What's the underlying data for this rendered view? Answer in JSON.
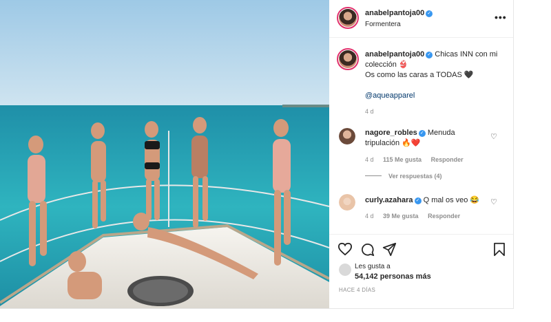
{
  "post": {
    "image_alt": "Group of women in swimsuits posing on the bow of a boat at sea",
    "colors": {
      "sky": "#a8cfe8",
      "sea": "#2aa7b4",
      "deck": "#f3f1ec"
    }
  },
  "header": {
    "username": "anabelpantoja00",
    "location": "Formentera",
    "verified": true
  },
  "caption": {
    "username": "anabelpantoja00",
    "text_line1": "Chicas INN con mi colección 👙",
    "text_line2": "Os como las caras a TODAS 🖤",
    "mention": "@aqueapparel",
    "time": "4 d"
  },
  "comments": [
    {
      "username": "nagore_robles",
      "text": "Menuda tripulación 🔥❤️",
      "time": "4 d",
      "likes": "115 Me gusta",
      "reply": "Responder",
      "view_replies": "Ver respuestas (4)"
    },
    {
      "username": "curly.azahara",
      "text": "Q mal os veo 😂",
      "time": "4 d",
      "likes": "39 Me gusta",
      "reply": "Responder"
    }
  ],
  "actions": {
    "likes_label": "Les gusta a",
    "likes_count": "54,142 personas más",
    "date": "HACE 4 DÍAS"
  }
}
